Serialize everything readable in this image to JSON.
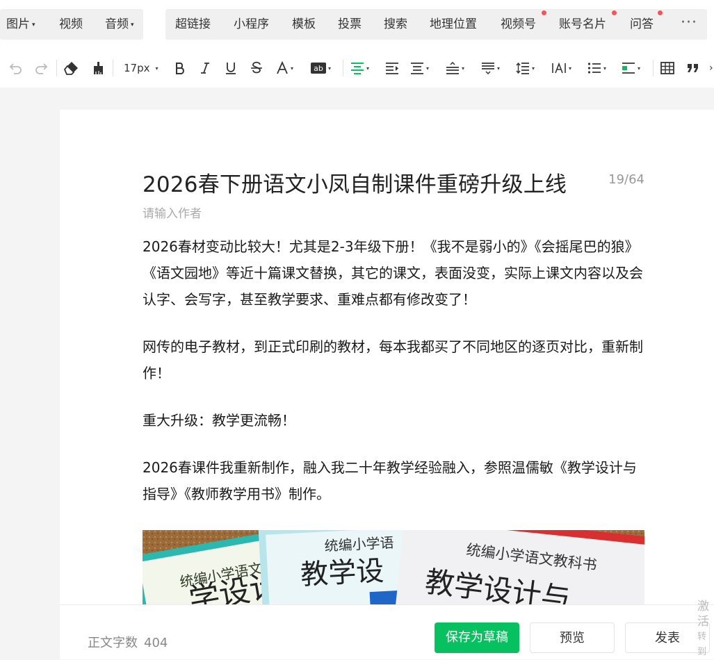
{
  "insert_bar": {
    "left_items": [
      {
        "label": "图片",
        "dropdown": true
      },
      {
        "label": "视频",
        "dropdown": false
      },
      {
        "label": "音频",
        "dropdown": true
      }
    ],
    "right_items": [
      {
        "label": "超链接",
        "dot": false
      },
      {
        "label": "小程序",
        "dot": false
      },
      {
        "label": "模板",
        "dot": false
      },
      {
        "label": "投票",
        "dot": false
      },
      {
        "label": "搜索",
        "dot": false
      },
      {
        "label": "地理位置",
        "dot": false
      },
      {
        "label": "视频号",
        "dot": true
      },
      {
        "label": "账号名片",
        "dot": true
      },
      {
        "label": "问答",
        "dot": true
      }
    ],
    "more": "···"
  },
  "format_bar": {
    "font_size": "17px"
  },
  "editor": {
    "title": "2026春下册语文小凤自制课件重磅升级上线",
    "title_count": "19/64",
    "author_placeholder": "请输入作者",
    "paragraphs": [
      "2026春材变动比较大！尤其是2-3年级下册！《我不是弱小的》《会摇尾巴的狼》《语文园地》等近十篇课文替换，其它的课文，表面没变，实际上课文内容以及会认字、会写字，甚至教学要求、重难点都有修改变了！",
      "网传的电子教材，到正式印刷的教材，每本我都买了不同地区的逐页对比，重新制作！",
      "重大升级：教学更流畅！",
      "2026春课件我重新制作，融入我二十年教学经验融入，参照温儒敏《教学设计与指导》《教师教学用书》制作。"
    ],
    "image_texts": {
      "book1_series": "统编小学语文",
      "book1_title": "学设计",
      "book2_series": "统编小学语",
      "book2_title": "教学设",
      "book3_series": "统编小学语文教科书",
      "book3_title": "教学设计与"
    }
  },
  "footer": {
    "word_count_label": "正文字数",
    "word_count": "404",
    "save_label": "保存为草稿",
    "preview_label": "预览",
    "publish_label": "发表"
  },
  "watermark": {
    "line1": "激活",
    "line2": "转到"
  },
  "colors": {
    "primary": "#07c160",
    "dot": "#fa5151"
  }
}
